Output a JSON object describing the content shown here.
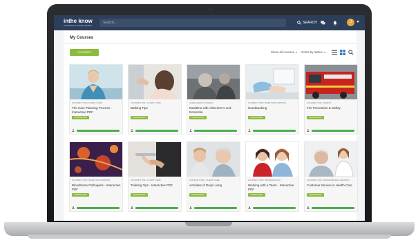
{
  "app": {
    "logo_main": "inthe know",
    "logo_sub": "LEARNING & DEVELOPMENT"
  },
  "header": {
    "search_placeholder": "Search...",
    "nav_label": "SEARCH",
    "avatar_initial": "J"
  },
  "page": {
    "title": "My Courses",
    "primary_button": "COURSES ENROLLED",
    "filter_show": "Show all courses",
    "filter_order": "Order by status"
  },
  "colors": {
    "topbar": "#2c3e59",
    "accent_green": "#8dbb3c",
    "progress_green": "#4cae4c"
  },
  "courses": [
    {
      "category": "COURSE TYPE / CLIENT CARE",
      "title": "The Care Planning Process - Interactive PDF",
      "status": "COMPLETED",
      "progress": 1.0
    },
    {
      "category": "COURSE TYPE / CLIENT CARE",
      "title": "Bathing Tips",
      "status": "COMPLETED",
      "progress": 1.0
    },
    {
      "category": "CAREGIVERS IN TERRA",
      "title": "Mealtime with Alzheimer's and Dementia",
      "status": "COMPLETED",
      "progress": 1.0
    },
    {
      "category": "COURSE TYPE / INFECTION CONTROL",
      "title": "Handwashing",
      "status": "COMPLETED",
      "progress": 1.0
    },
    {
      "category": "COURSE TYPE / SAFETY",
      "title": "Fire Prevention & Safety",
      "status": "COMPLETED",
      "progress": 1.0
    },
    {
      "category": "COURSE TYPE / INFECTION CONTROL",
      "title": "Bloodborne Pathogens - Interactive PDF",
      "status": "COMPLETED",
      "progress": 1.0
    },
    {
      "category": "COURSE TYPE / CLIENT CARE",
      "title": "Toileting Tips - Interactive PDF",
      "status": "COMPLETED",
      "progress": 1.0
    },
    {
      "category": "COURSE TYPE / CLIENT CARE",
      "title": "Activities of Daily Living",
      "status": "COMPLETED",
      "progress": 1.0
    },
    {
      "category": "COURSE TYPE / PROFESSIONAL",
      "title": "Working with a Team - Interactive PDF",
      "status": "COMPLETED",
      "progress": 1.0
    },
    {
      "category": "COURSE TYPE / PROFESSIONAL GROWTH",
      "title": "Customer Service in Health Care",
      "status": "COMPLETED",
      "progress": 1.0
    }
  ]
}
